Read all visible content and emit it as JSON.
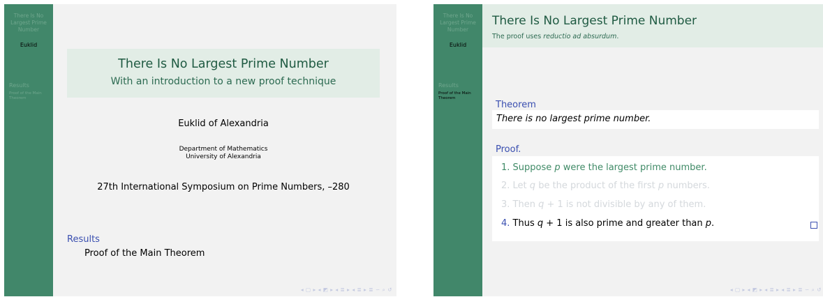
{
  "sidebar": {
    "title_lines": [
      "There Is No",
      "Largest Prime",
      "Number"
    ],
    "author": "Euklid",
    "section": "Results",
    "subsection_lines": [
      "Proof of the Main",
      "Theorem"
    ]
  },
  "nav_symbols": "◂ ▢ ▸ ◂ ◩ ▸ ◂ ≣ ▸ ◂ ≣ ▸   ≣   ∽ ⌕ ↺",
  "slide1": {
    "title": "There Is No Largest Prime Number",
    "subtitle": "With an introduction to a new proof technique",
    "author": "Euklid of Alexandria",
    "institute_lines": [
      "Department of Mathematics",
      "University of Alexandria"
    ],
    "date": "27th International Symposium on Prime Numbers, –280",
    "toc": {
      "section": "Results",
      "subsection": "Proof of the Main Theorem"
    }
  },
  "slide2": {
    "frame_title": "There Is No Largest Prime Number",
    "frame_subtitle_prefix": "The proof uses ",
    "frame_subtitle_emph": "reductio ad absurdum",
    "frame_subtitle_suffix": ".",
    "theorem_title": "Theorem",
    "theorem_body": "There is no largest prime number.",
    "proof_title": "Proof.",
    "proof_items": [
      {
        "num": "1.",
        "pre": "Suppose ",
        "var": "p",
        "post": " were the largest prime number."
      },
      {
        "num": "2.",
        "pre": "Let ",
        "var": "q",
        "mid": " be the product of the first ",
        "var2": "p",
        "post": " numbers."
      },
      {
        "num": "3.",
        "pre": "Then ",
        "var": "q",
        "post": " + 1 is not divisible by any of them."
      },
      {
        "num": "4.",
        "pre": "Thus ",
        "var": "q",
        "mid": " + 1 is also prime and greater than ",
        "var2": "p",
        "post": "."
      }
    ]
  },
  "colors": {
    "sidebar": "#41876a",
    "title_box": "#e2ede6",
    "block_title": "#3a4fb0",
    "slide_bg": "#f2f2f2"
  }
}
